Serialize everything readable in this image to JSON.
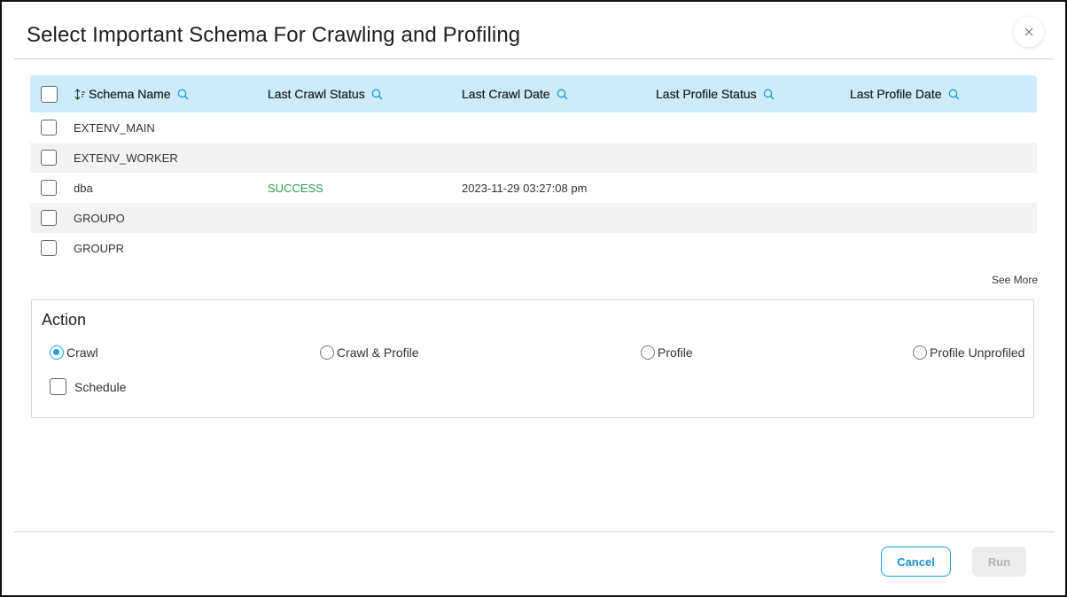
{
  "dialog": {
    "title": "Select Important Schema For Crawling and Profiling",
    "close_icon": "close-icon"
  },
  "table": {
    "columns": [
      {
        "label": "Schema Name",
        "icon": "search-icon"
      },
      {
        "label": "Last Crawl Status",
        "icon": "search-icon"
      },
      {
        "label": "Last Crawl Date",
        "icon": "search-icon"
      },
      {
        "label": "Last Profile Status",
        "icon": "search-icon"
      },
      {
        "label": "Last Profile Date",
        "icon": "search-icon"
      }
    ],
    "sort_icon": "sort-icon",
    "rows": [
      {
        "schema": "EXTENV_MAIN",
        "crawl_status": "",
        "crawl_date": "",
        "profile_status": "",
        "profile_date": ""
      },
      {
        "schema": "EXTENV_WORKER",
        "crawl_status": "",
        "crawl_date": "",
        "profile_status": "",
        "profile_date": ""
      },
      {
        "schema": "dba",
        "crawl_status": "SUCCESS",
        "crawl_date": "2023-11-29 03:27:08 pm",
        "profile_status": "",
        "profile_date": ""
      },
      {
        "schema": "GROUPO",
        "crawl_status": "",
        "crawl_date": "",
        "profile_status": "",
        "profile_date": ""
      },
      {
        "schema": "GROUPR",
        "crawl_status": "",
        "crawl_date": "",
        "profile_status": "",
        "profile_date": ""
      }
    ],
    "see_more": "See More"
  },
  "action": {
    "title": "Action",
    "options": [
      {
        "label": "Crawl",
        "selected": true
      },
      {
        "label": "Crawl & Profile",
        "selected": false
      },
      {
        "label": "Profile",
        "selected": false
      },
      {
        "label": "Profile Unprofiled",
        "selected": false
      }
    ],
    "schedule_label": "Schedule"
  },
  "footer": {
    "cancel_label": "Cancel",
    "run_label": "Run"
  },
  "colors": {
    "header_bg": "#cdebf8",
    "accent": "#1aa0d8",
    "success": "#2e9b4c"
  }
}
